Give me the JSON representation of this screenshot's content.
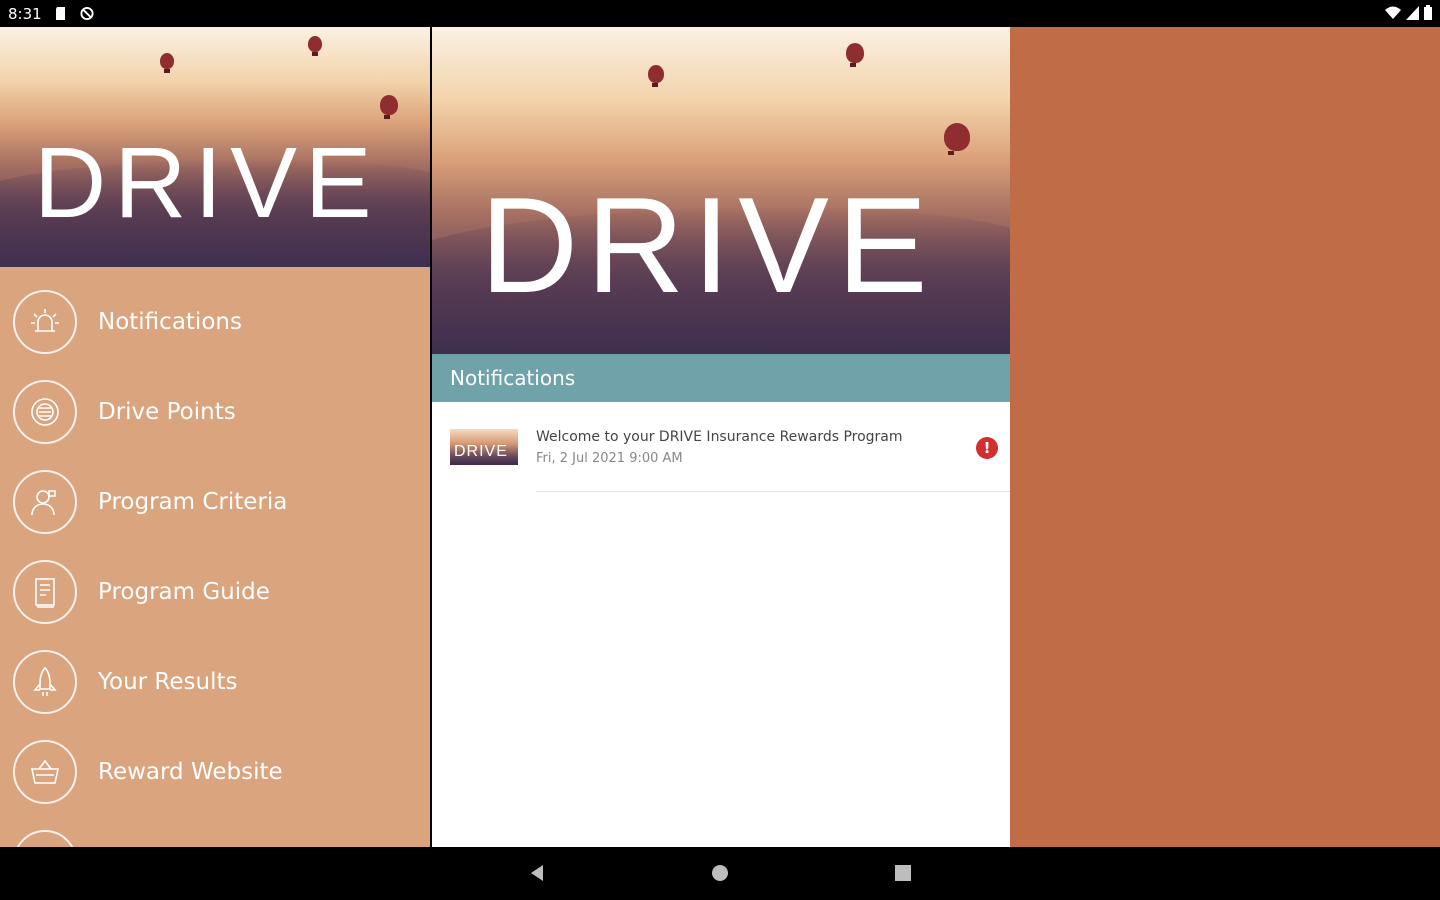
{
  "status_bar": {
    "time": "8:31",
    "left_icons": [
      "sd-card-icon",
      "no-sync-icon"
    ],
    "right_icons": [
      "wifi-icon",
      "signal-icon",
      "battery-icon"
    ]
  },
  "drawer": {
    "logo_text": "DRIVE",
    "menu": [
      {
        "label": "Notifications",
        "icon": "siren-icon"
      },
      {
        "label": "Drive Points",
        "icon": "badge-icon"
      },
      {
        "label": "Program Criteria",
        "icon": "person-icon"
      },
      {
        "label": "Program Guide",
        "icon": "book-icon"
      },
      {
        "label": "Your Results",
        "icon": "rocket-icon"
      },
      {
        "label": "Reward Website",
        "icon": "basket-icon"
      }
    ]
  },
  "main": {
    "logo_text": "DRIVE",
    "section_title": "Notifications",
    "notifications": [
      {
        "thumb_text": "DRIVE",
        "title": "Welcome to your DRIVE Insurance Rewards Program",
        "date": "Fri, 2 Jul 2021 9:00 AM",
        "badge": "!"
      }
    ]
  },
  "colors": {
    "drawer_bg": "#d9a47e",
    "section_bar": "#6fa3a9",
    "right_pane": "#bf6c47",
    "alert": "#d32f2f"
  },
  "nav_bar": {
    "buttons": [
      "back-button",
      "home-button",
      "recents-button"
    ]
  }
}
